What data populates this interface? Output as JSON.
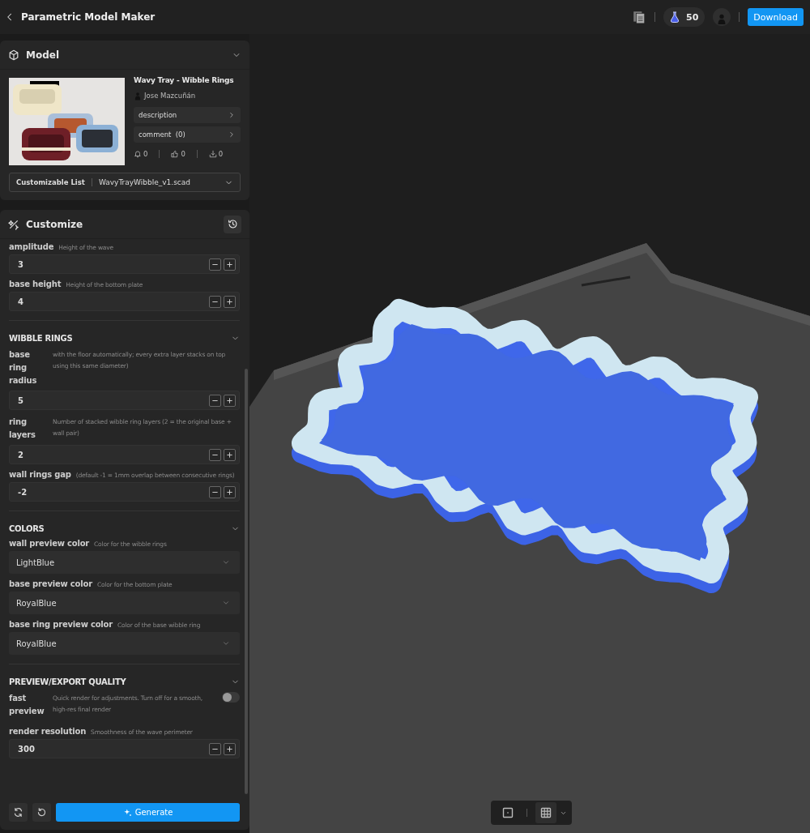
{
  "app_bar": {
    "title": "Parametric Model Maker",
    "credits": "50",
    "action": "Download"
  },
  "model_panel": {
    "title": "Model",
    "expanded": true,
    "model_title": "Wavy Tray - Wibble Rings",
    "author": "Jose Mazcuñán",
    "links": [
      {
        "label": "description"
      },
      {
        "label": "comment  (0)"
      }
    ],
    "stats": [
      {
        "kind": "bell",
        "count": "0"
      },
      {
        "kind": "like",
        "count": "0"
      },
      {
        "kind": "download",
        "count": "0"
      }
    ],
    "file_select": {
      "label": "Customizable List",
      "value": "WavyTrayWibble_v1.scad"
    }
  },
  "customize_panel": {
    "title": "Customize",
    "sections": [
      {
        "expanded": true,
        "params": [
          {
            "kind": "number",
            "label": "amplitude",
            "description": "Height of the wave",
            "value": "3"
          },
          {
            "kind": "number",
            "label": "base height",
            "description": "Height of the bottom plate",
            "value": "4"
          }
        ]
      },
      {
        "title": "WIBBLE RINGS",
        "expanded": true,
        "params": [
          {
            "kind": "number",
            "label": "base ring radius",
            "description": "with the floor automatically; every extra layer stacks on top using this same diameter)",
            "value": "5"
          },
          {
            "kind": "number",
            "label": "ring layers",
            "description": "Number of stacked wibble ring layers (2 = the original base + wall pair)",
            "value": "2"
          },
          {
            "kind": "number",
            "label": "wall rings gap",
            "description": "(default -1 = 1mm overlap between consecutive rings)",
            "value": "-2"
          }
        ]
      },
      {
        "title": "COLORS",
        "expanded": true,
        "params": [
          {
            "kind": "select",
            "label": "wall preview color",
            "description": "Color for the wibble rings",
            "value": "LightBlue"
          },
          {
            "kind": "select",
            "label": "base preview color",
            "description": "Color for the bottom plate",
            "value": "RoyalBlue"
          },
          {
            "kind": "select",
            "label": "base ring preview color",
            "description": "Color of the base wibble ring",
            "value": "RoyalBlue"
          }
        ]
      },
      {
        "title": "PREVIEW/EXPORT QUALITY",
        "expanded": true,
        "params": [
          {
            "kind": "toggle",
            "label": "fast preview",
            "description": "Quick render for adjustments. Turn off for a smooth, high-res final render",
            "on": false
          },
          {
            "kind": "number",
            "label": "render resolution",
            "description": "Smoothness of the wave perimeter",
            "value": "300"
          }
        ]
      }
    ],
    "generate": "Generate"
  },
  "viewport": {
    "view_buttons": [
      {
        "kind": "frame",
        "selected": false
      },
      {
        "kind": "grid",
        "selected": true
      }
    ]
  }
}
